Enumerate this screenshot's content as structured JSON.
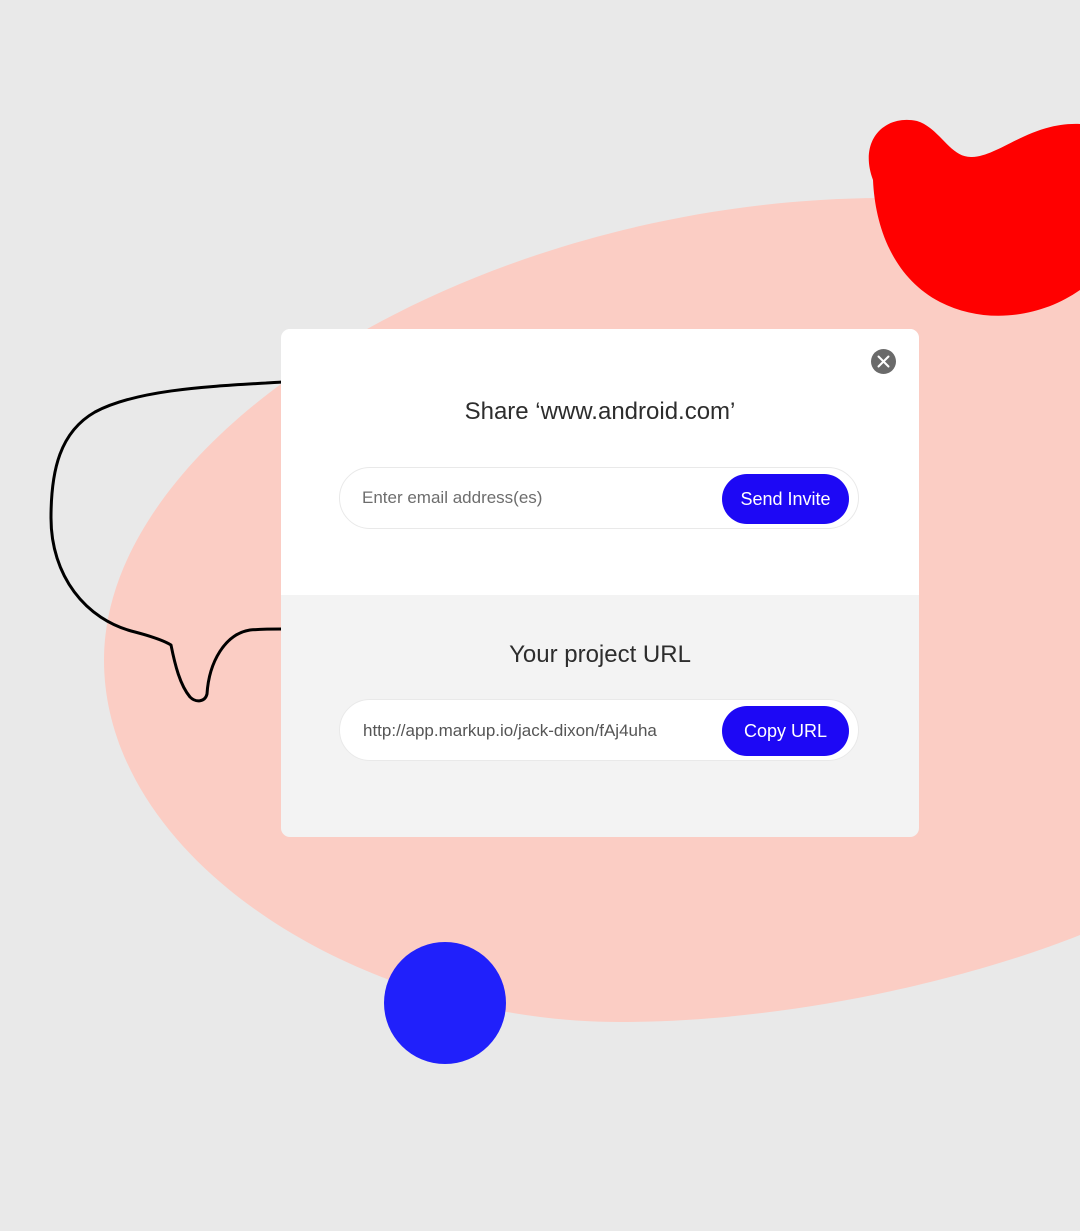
{
  "colors": {
    "page_background": "#e9e9e9",
    "salmon_blob": "#fbcdc4",
    "red_blob": "#ff0000",
    "blue_dot": "#2020fb",
    "accent_button": "#1d08f5",
    "modal_top": "#ffffff",
    "modal_bottom": "#f3f3f3"
  },
  "decor": {
    "speech_bubble_icon": "speech-bubble-outline",
    "close_icon": "close-x-circle"
  },
  "share_dialog": {
    "title": "Share ‘www.android.com’",
    "invite": {
      "email_placeholder": "Enter email address(es)",
      "email_value": "",
      "send_label": "Send Invite"
    },
    "project_url": {
      "title": "Your project URL",
      "url": "http://app.markup.io/jack-dixon/fAj4uha",
      "copy_label": "Copy URL"
    }
  }
}
